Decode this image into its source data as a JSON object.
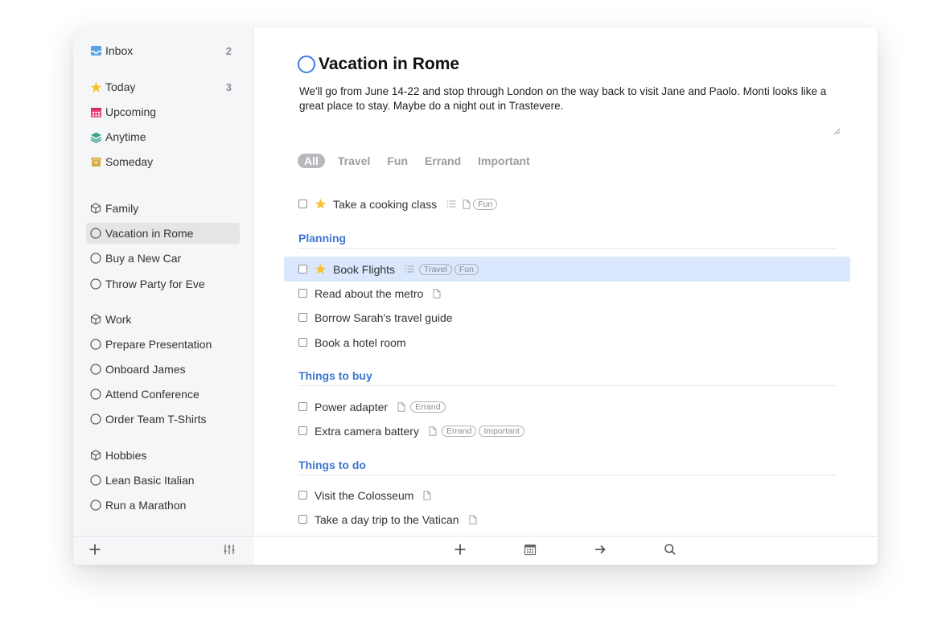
{
  "sidebar": {
    "items": [
      {
        "label": "Inbox",
        "count": "2",
        "icon": "inbox-icon"
      },
      {
        "label": "Today",
        "count": "3",
        "icon": "star-icon"
      },
      {
        "label": "Upcoming",
        "icon": "calendar-icon"
      },
      {
        "label": "Anytime",
        "icon": "layers-icon"
      },
      {
        "label": "Someday",
        "icon": "archive-box-icon"
      }
    ],
    "areas": [
      {
        "label": "Family",
        "projects": [
          "Vacation in Rome",
          "Buy a New Car",
          "Throw Party for Eve"
        ]
      },
      {
        "label": "Work",
        "projects": [
          "Prepare Presentation",
          "Onboard James",
          "Attend Conference",
          "Order Team T-Shirts"
        ]
      },
      {
        "label": "Hobbies",
        "projects": [
          "Lean Basic Italian",
          "Run a Marathon"
        ]
      }
    ],
    "selected": "Vacation in Rome"
  },
  "project": {
    "title": "Vacation in Rome",
    "notes": "We'll go from June 14-22 and stop through London on the way back to visit Jane and Paolo. Monti looks like a great place to stay. Maybe do a night out in Trastevere."
  },
  "tag_filters": [
    "All",
    "Travel",
    "Fun",
    "Errand",
    "Important"
  ],
  "loose_todos": [
    {
      "label": "Take a cooking class",
      "starred": true,
      "checklist": true,
      "note": true,
      "tags": [
        "Fun"
      ]
    }
  ],
  "headings": [
    {
      "title": "Planning",
      "todos": [
        {
          "label": "Book Flights",
          "starred": true,
          "checklist": true,
          "tags": [
            "Travel",
            "Fun"
          ],
          "selected": true
        },
        {
          "label": "Read about the metro",
          "note": true
        },
        {
          "label": "Borrow Sarah's travel guide"
        },
        {
          "label": "Book a hotel room"
        }
      ]
    },
    {
      "title": "Things to buy",
      "todos": [
        {
          "label": "Power adapter",
          "note": true,
          "tags": [
            "Errand"
          ]
        },
        {
          "label": "Extra camera battery",
          "note": true,
          "tags": [
            "Errand",
            "Important"
          ]
        }
      ]
    },
    {
      "title": "Things to do",
      "todos": [
        {
          "label": "Visit the Colosseum",
          "note": true
        },
        {
          "label": "Take a day trip to the Vatican",
          "note": true
        }
      ]
    }
  ],
  "colors": {
    "accent": "#3c7fe0",
    "heading": "#3d76cf",
    "star": "#f7c12f",
    "selected_row": "#dae7fd",
    "sidebar_bg": "#f5f6f8"
  },
  "toolbar_icons": [
    "plus-icon",
    "calendar-icon",
    "arrow-right-icon",
    "search-icon"
  ],
  "sidebar_toolbar_icons": [
    "plus-icon",
    "sliders-icon"
  ]
}
